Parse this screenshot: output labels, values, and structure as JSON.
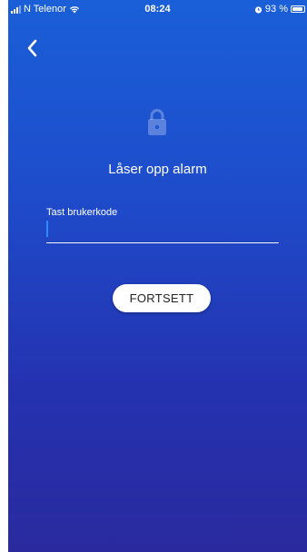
{
  "status_bar": {
    "carrier": "N Telenor",
    "time": "08:24",
    "battery": "93 %",
    "battery_level": 0.93
  },
  "nav": {
    "back_icon": "chevron-left-icon"
  },
  "main": {
    "lock_icon": "lock-icon",
    "title": "Låser opp alarm",
    "field_label": "Tast brukerkode",
    "field_value": "",
    "continue_label": "FORTSETT"
  },
  "colors": {
    "gradient_top": "#1a5fd8",
    "gradient_bottom": "#2a2a9e",
    "caret": "#2f8cff"
  }
}
